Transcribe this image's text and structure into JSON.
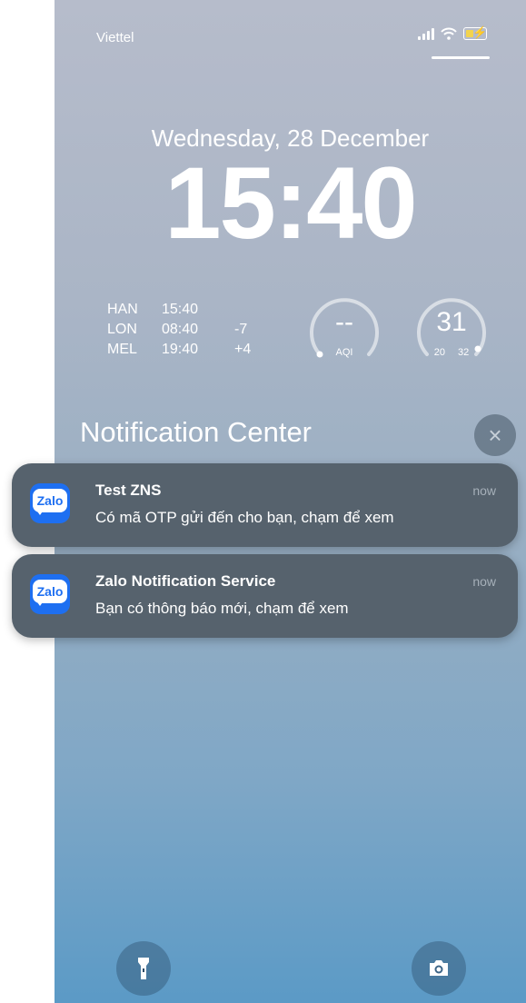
{
  "status_bar": {
    "carrier": "Viettel"
  },
  "lock_screen": {
    "date": "Wednesday, 28 December",
    "time": "15:40"
  },
  "world_clock": [
    {
      "city": "HAN",
      "time": "15:40",
      "offset": ""
    },
    {
      "city": "LON",
      "time": "08:40",
      "offset": "-7"
    },
    {
      "city": "MEL",
      "time": "19:40",
      "offset": "+4"
    }
  ],
  "widgets": {
    "aqi": {
      "value": "--",
      "label": "AQI"
    },
    "temperature": {
      "value": "31",
      "low": "20",
      "high": "32"
    }
  },
  "notification_center": {
    "title": "Notification Center",
    "notifications": [
      {
        "app_icon_text": "Zalo",
        "title": "Test ZNS",
        "time": "now",
        "body": "Có mã OTP gửi đến cho bạn, chạm để xem"
      },
      {
        "app_icon_text": "Zalo",
        "title": "Zalo Notification Service",
        "time": "now",
        "body": "Bạn có thông báo mới, chạm để xem"
      }
    ]
  },
  "icons": {
    "clear": "close-icon",
    "flashlight": "flashlight-icon",
    "camera": "camera-icon",
    "signal": "signal-icon",
    "wifi": "wifi-icon",
    "battery": "battery-icon"
  },
  "colors": {
    "zalo_blue": "#1e6ff1",
    "battery_fill": "#f2d34d",
    "notification_bg": "#56626d"
  }
}
